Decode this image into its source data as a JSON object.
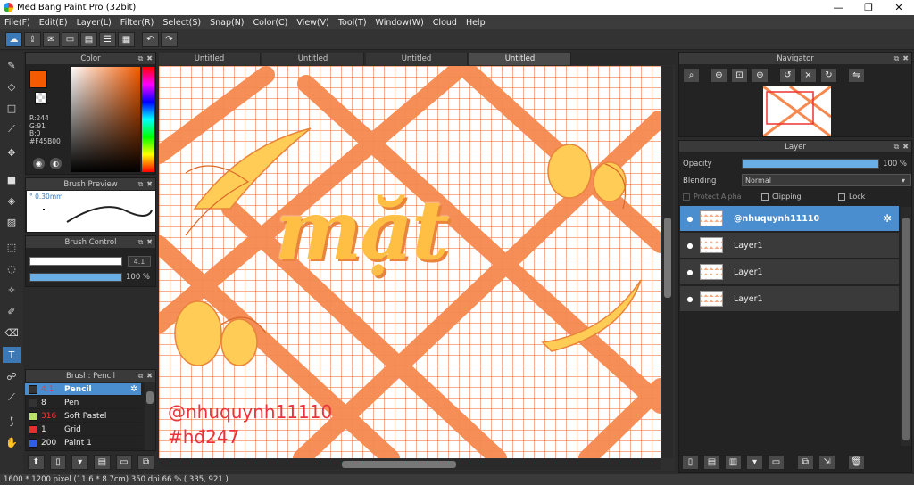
{
  "window": {
    "title": "MediBang Paint Pro (32bit)",
    "minimize": "—",
    "maximize": "❐",
    "close": "✕"
  },
  "menu": [
    "File(F)",
    "Edit(E)",
    "Layer(L)",
    "Filter(R)",
    "Select(S)",
    "Snap(N)",
    "Color(C)",
    "View(V)",
    "Tool(T)",
    "Window(W)",
    "Cloud",
    "Help"
  ],
  "color_panel": {
    "title": "Color",
    "r": "R:244",
    "g": "G:91",
    "b": "B:0",
    "hex": "#F45B00",
    "primary": "#F45B00"
  },
  "brush_preview": {
    "title": "Brush Preview",
    "size": "° 0.30mm"
  },
  "brush_control": {
    "title": "Brush Control",
    "size_value": "4.1",
    "opacity_value": "100 %",
    "opacity": 1.0
  },
  "brush_list": {
    "title": "Brush: Pencil",
    "items": [
      {
        "size": "4.1",
        "name": "Pencil",
        "color": "#333333"
      },
      {
        "size": "8",
        "name": "Pen",
        "color": "#333333"
      },
      {
        "size": "316",
        "name": "Soft Pastel",
        "color": "#b8e06a"
      },
      {
        "size": "1",
        "name": "Grid",
        "color": "#e53030"
      },
      {
        "size": "200",
        "name": "Paint 1",
        "color": "#3060e0"
      }
    ]
  },
  "tabs": [
    "Untitled",
    "Untitled",
    "Untitled",
    "Untitled"
  ],
  "canvas": {
    "title_text": "mặt",
    "handle": "@nhuquynh11110",
    "hashtag": "#hđ247"
  },
  "navigator": {
    "title": "Navigator"
  },
  "layer_panel": {
    "title": "Layer",
    "opacity_label": "Opacity",
    "opacity_value": "100 %",
    "opacity": 1.0,
    "blending_label": "Blending",
    "blending_value": "Normal",
    "protect_alpha": "Protect Alpha",
    "clipping": "Clipping",
    "lock": "Lock",
    "layers": [
      "@nhuquynh11110",
      "Layer1",
      "Layer1",
      "Layer1"
    ]
  },
  "status": {
    "text": "1600 * 1200 pixel   (11.6 * 8.7cm)   350 dpi   66 %   ( 335, 921 )"
  },
  "colors": {
    "accent": "#4a8ed0",
    "stripe": "#f5894f",
    "text_red": "#e8333f",
    "yellow": "#ffcc55"
  }
}
